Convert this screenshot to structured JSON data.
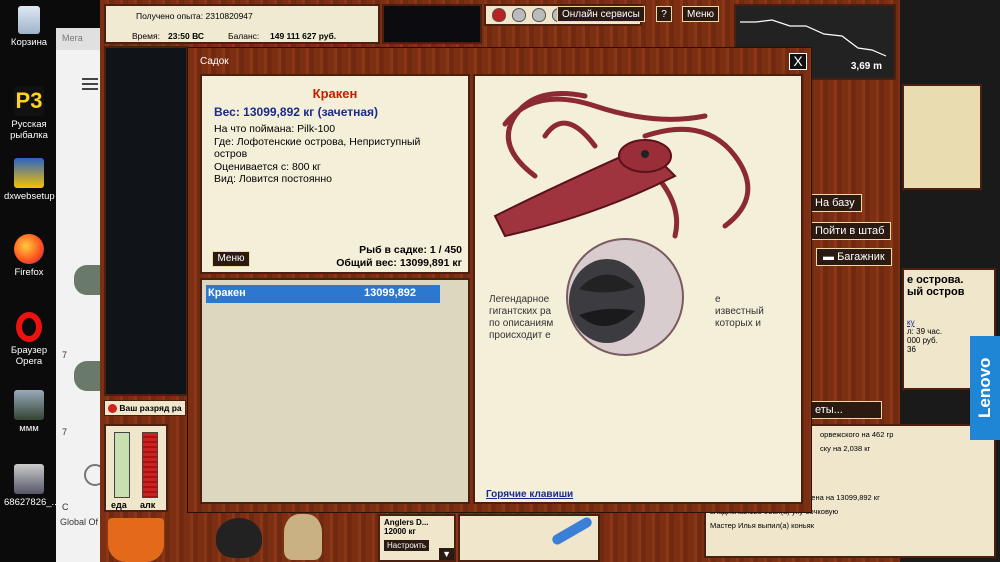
{
  "desktop": {
    "icons": [
      {
        "label": "Корзина"
      },
      {
        "label": "Русская рыбалка"
      },
      {
        "label": "dxwebsetup"
      },
      {
        "label": "Firefox"
      },
      {
        "label": "Браузер Opera"
      },
      {
        "label": "ммм"
      },
      {
        "label": "68627826_..."
      }
    ],
    "browser_tab": "Мега",
    "edge_labels": [
      "7",
      "7",
      "C",
      "Global Of"
    ]
  },
  "game": {
    "exp_text": "Получено опыта: 2310820947",
    "time_label": "Время:",
    "time_value": "23:50 ВС",
    "balance_label": "Баланс:",
    "balance_value": "149 111 627 руб.",
    "online_button": "Онлайн сервисы",
    "help_button": "?",
    "menu_button": "Меню",
    "depth": "3,69 m",
    "base_button": "На базу",
    "hq_button": "Пойти в штаб",
    "trunk_button": "Багажник",
    "side_info": [
      "е острова.",
      "ый остров"
    ],
    "side_small": [
      "ку",
      "л: 39 час.",
      "000 руб.",
      "36"
    ],
    "side_button": "еты...",
    "warning": "Ваш разряд ра",
    "gauge_labels": [
      "еда",
      "алк"
    ],
    "bottom_widget": {
      "title": "Anglers D...",
      "value": "12000 кг",
      "button": "Настроить"
    },
    "chat": [
      "Мастер Илья поймал(а) Кракена на 13099,892 кг",
      "владислав.123 съел(а) уху бочковую",
      "Мастер Илья выпил(а) коньяк"
    ],
    "chat_partial": [
      "орвежского на 462 гр",
      "ску на 2,038 кг"
    ]
  },
  "modal": {
    "title": "Садок",
    "close_label": "X",
    "fish_name": "Кракен",
    "fish_weight": "Вес: 13099,892 кг (зачетная)",
    "details": [
      "На что поймана: Pilk-100",
      "Где: Лофотенские острова, Неприступный остров",
      "Оценивается с: 800 кг",
      "Вид: Ловится постоянно"
    ],
    "menu_button": "Меню",
    "fish_count": "Рыб в садке: 1 / 450",
    "total_weight": "Общий вес: 13099,891 кг",
    "list": [
      {
        "name": "Кракен",
        "weight": "13099,892"
      }
    ],
    "description": [
      "Легендарное",
      "гигантских ра",
      "по описаниям",
      "происходит е"
    ],
    "description_right": [
      "е",
      "известный",
      "которых и"
    ],
    "hotkeys_link": "Горячие клавиши"
  }
}
